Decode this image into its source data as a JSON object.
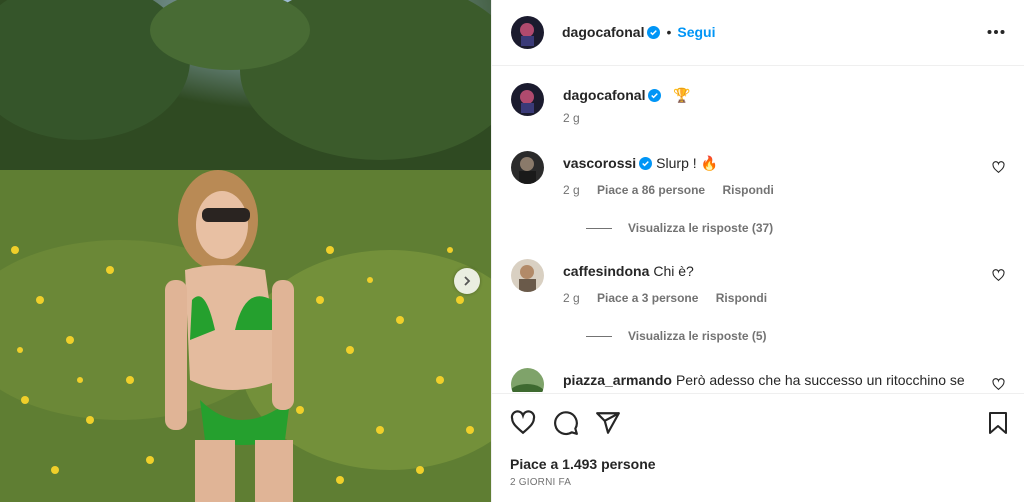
{
  "post": {
    "author": "dagocafonal",
    "follow_label": "Segui",
    "separator": "•"
  },
  "caption": {
    "author": "dagocafonal",
    "emoji": "🏆",
    "age": "2 g"
  },
  "comments": [
    {
      "user": "vascorossi",
      "verified": true,
      "text": "Slurp ! 🔥",
      "age": "2 g",
      "likes": "Piace a 86 persone",
      "reply": "Rispondi",
      "view_replies": "Visualizza le risposte (37)"
    },
    {
      "user": "caffesindona",
      "verified": false,
      "text": "Chi è?",
      "age": "2 g",
      "likes": "Piace a 3 persone",
      "reply": "Rispondi",
      "view_replies": "Visualizza le risposte (5)"
    },
    {
      "user": "piazza_armando",
      "verified": false,
      "text": "Però adesso che ha successo un ritocchino se"
    }
  ],
  "likes_total": "Piace a 1.493 persone",
  "posted": "2 GIORNI FA",
  "colors": {
    "accent": "#0095f6",
    "verified": "#0095f6",
    "text": "#262626",
    "muted": "#737373"
  }
}
